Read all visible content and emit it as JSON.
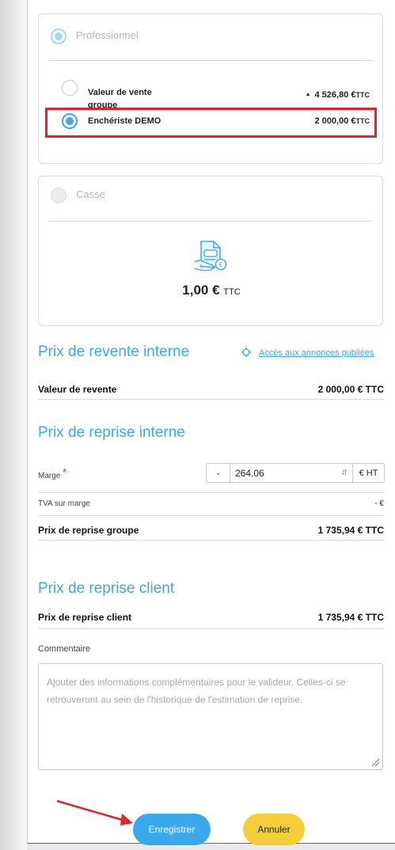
{
  "professional": {
    "label": "Professionnel",
    "options": [
      {
        "label_line1": "Valeur de vente",
        "label_line2": "groupe",
        "arrow": "▲",
        "value": "4 526,80 €",
        "unit": "TTC"
      },
      {
        "label": "Enchériste DEMO",
        "value": "2 000,00 €",
        "unit": "TTC"
      }
    ]
  },
  "casse": {
    "label": "Casse",
    "price": "1,00 €",
    "unit": "TTC"
  },
  "resale": {
    "title": "Prix de revente interne",
    "link": "Accès aux annonces publiées",
    "row_label": "Valeur de revente",
    "row_value": "2 000,00 € TTC"
  },
  "takeover": {
    "title": "Prix de reprise interne",
    "margin_label": "Marge",
    "required": "*",
    "minus": "-",
    "margin_value": "264.06",
    "margin_unit": "€ HT",
    "vat_label": "TVA sur marge",
    "vat_value": "- €",
    "group_label": "Prix de reprise groupe",
    "group_value": "1 735,94 € TTC"
  },
  "client": {
    "title": "Prix de reprise client",
    "row_label": "Prix de reprise client",
    "row_value": "1 735,94 € TTC",
    "comment_label": "Commentaire",
    "comment_placeholder": "Ajouter des informations complémentaires pour le valideur. Celles-ci se retrouveront au sein de l'historique de l'estimation de reprise."
  },
  "actions": {
    "save": "Enregistrer",
    "cancel": "Annuler"
  },
  "colors": {
    "accent": "#3aa9ec",
    "highlight": "#e0242a",
    "cancel": "#f5cf3a"
  }
}
